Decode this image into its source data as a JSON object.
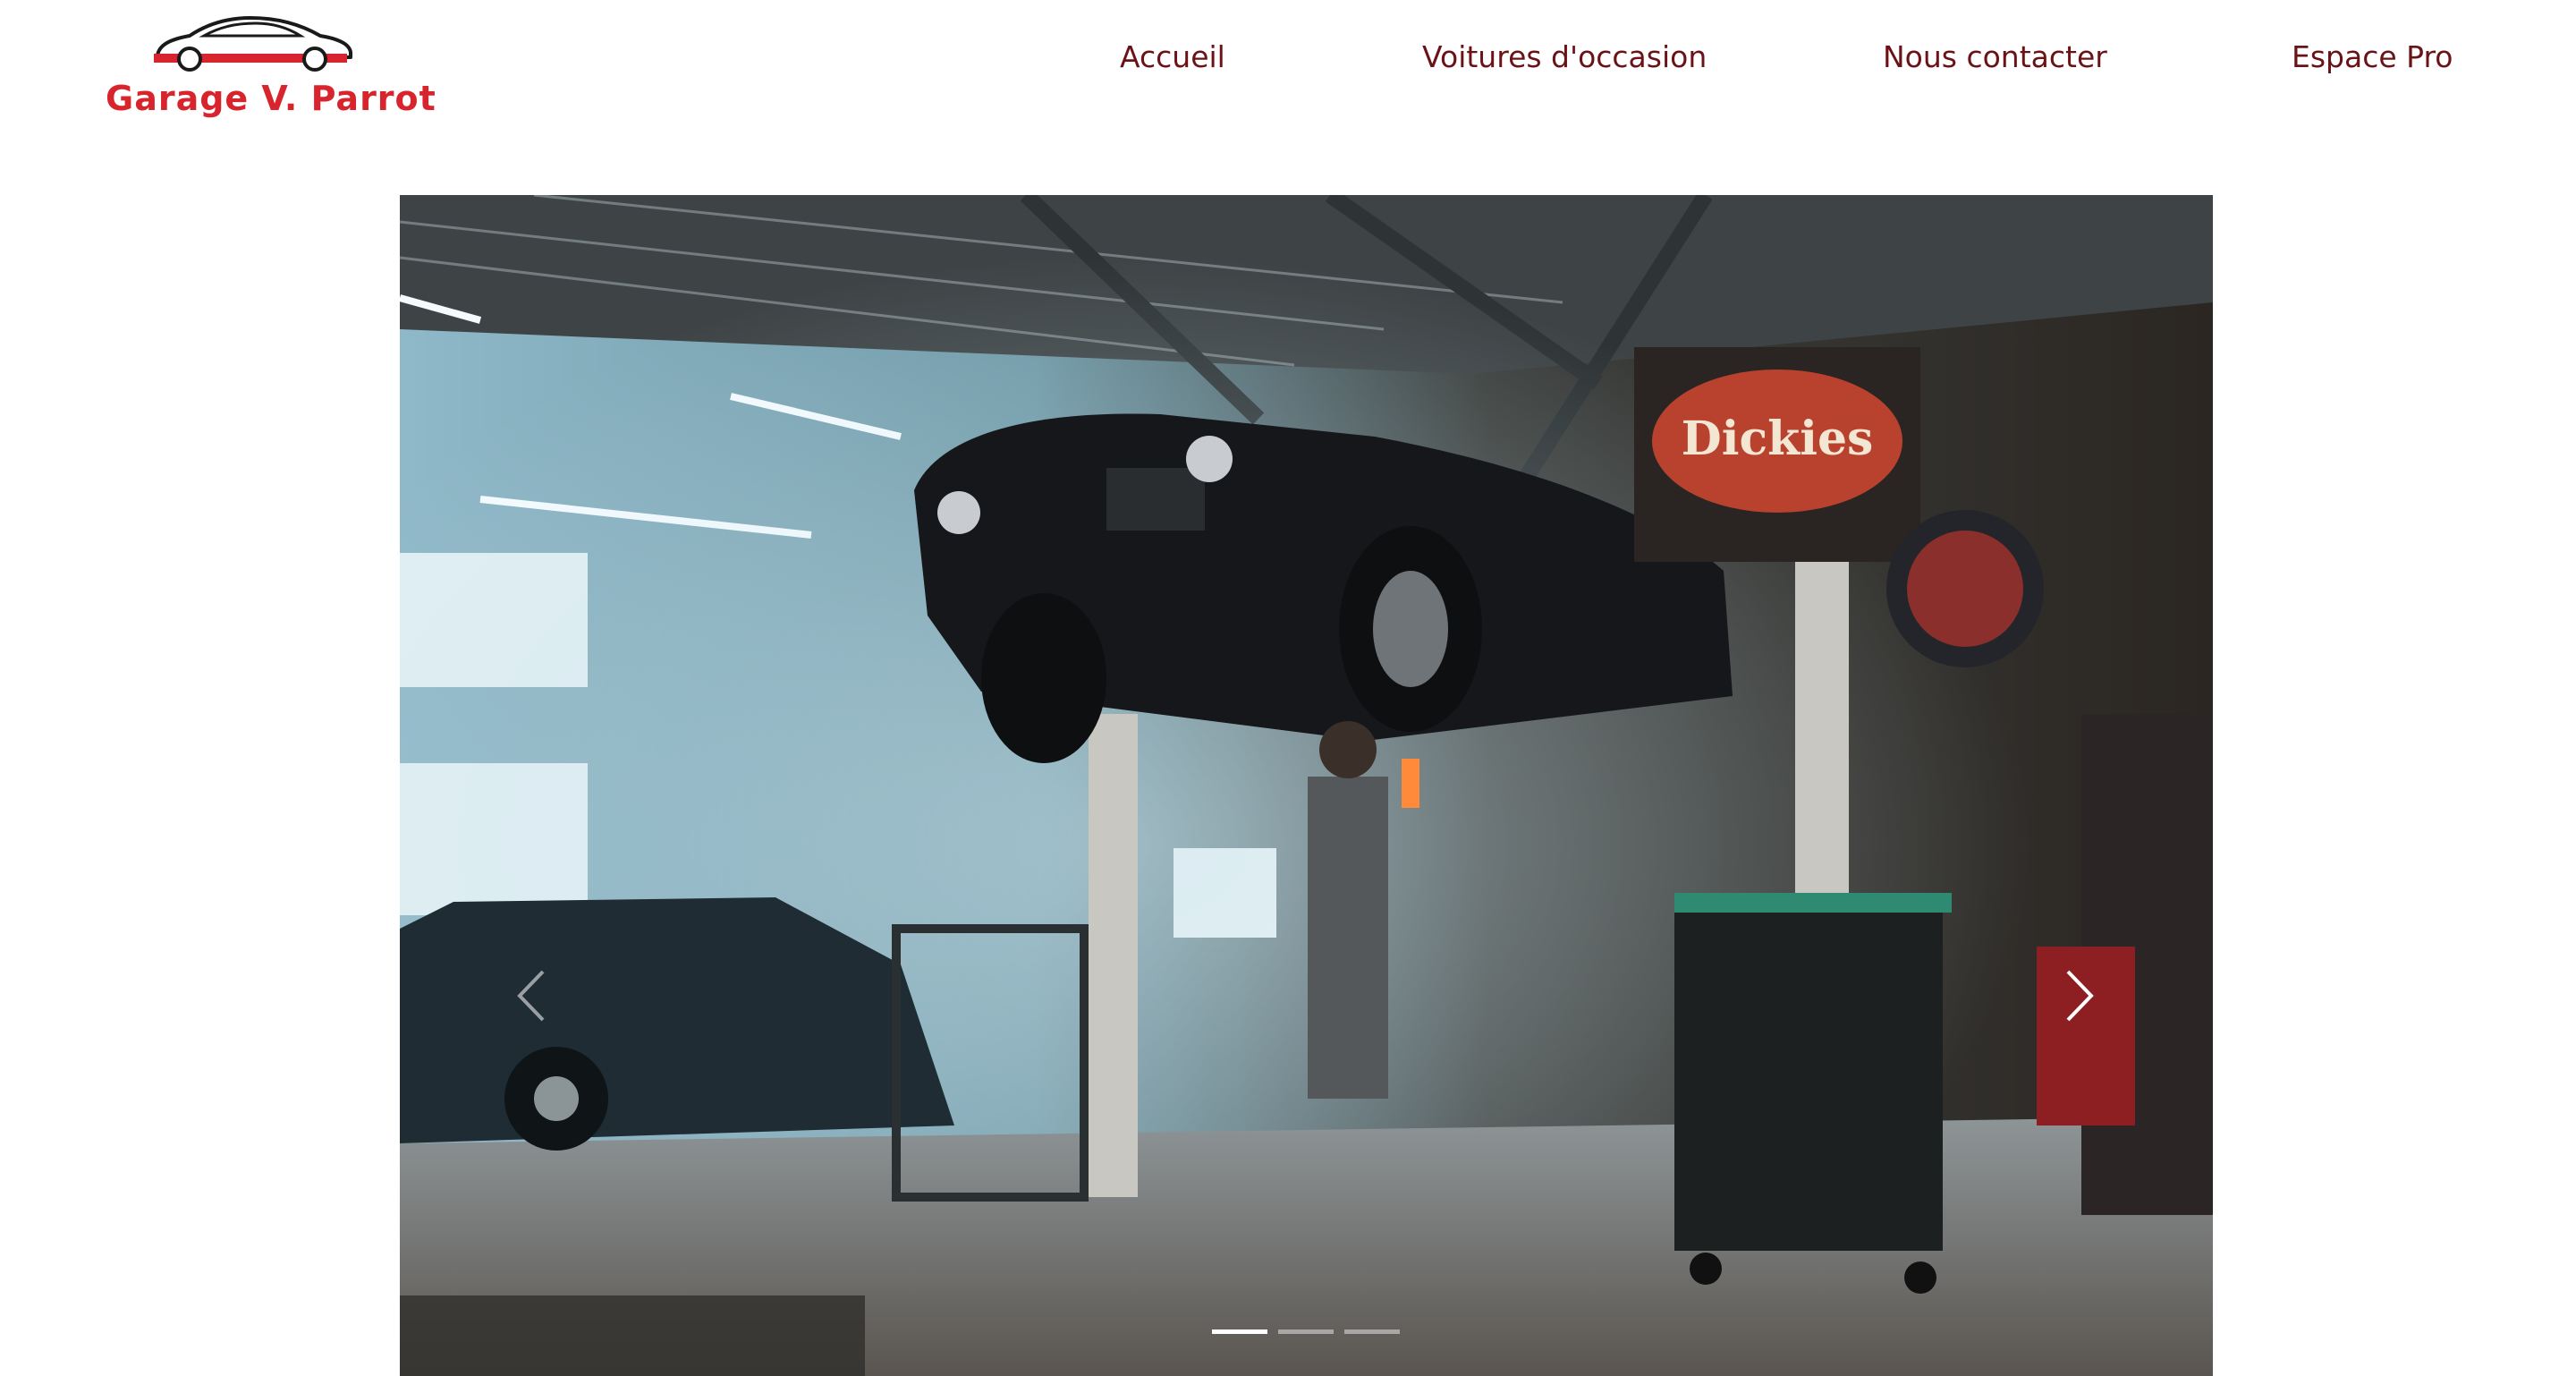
{
  "brand": {
    "name": "Garage V. Parrot",
    "accent_color": "#d8242c",
    "logo_icon": "car-wrench-icon"
  },
  "nav": {
    "items": [
      {
        "label": "Accueil"
      },
      {
        "label": "Voitures d'occasion"
      },
      {
        "label": "Nous contacter"
      },
      {
        "label": "Espace Pro"
      }
    ],
    "color": "#6b1217"
  },
  "carousel": {
    "slide_count": 3,
    "active_index": 0,
    "prev_icon": "chevron-left-icon",
    "next_icon": "chevron-right-icon"
  }
}
